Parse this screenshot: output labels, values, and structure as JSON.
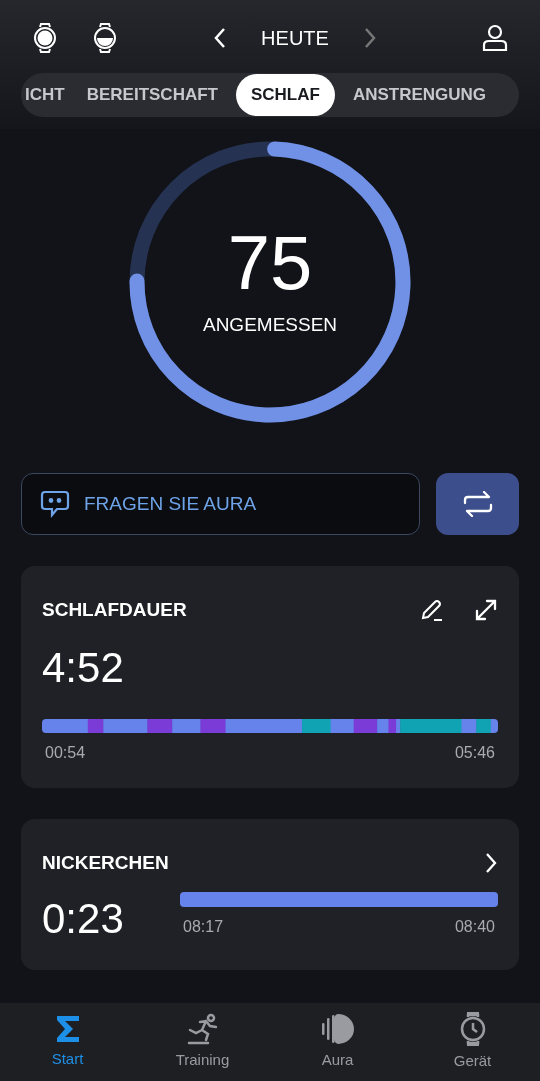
{
  "header": {
    "title": "HEUTE"
  },
  "tabs": [
    {
      "label": "ICHT",
      "selected": false
    },
    {
      "label": "BEREITSCHAFT",
      "selected": false
    },
    {
      "label": "SCHLAF",
      "selected": true
    },
    {
      "label": "ANSTRENGUNG",
      "selected": false
    }
  ],
  "score": {
    "value": "75",
    "label": "ANGEMESSEN",
    "level": 0.75
  },
  "ask_button": {
    "label": "FRAGEN SIE AURA"
  },
  "sleep_card": {
    "title": "SCHLAFDAUER",
    "duration": "4:52",
    "start": "00:54",
    "end": "05:46"
  },
  "nap_card": {
    "title": "NICKERCHEN",
    "duration": "0:23",
    "start": "08:17",
    "end": "08:40",
    "level": 1
  },
  "nav": [
    {
      "label": "Start",
      "selected": true,
      "kind": "sigma"
    },
    {
      "label": "Training",
      "selected": false,
      "kind": "runner"
    },
    {
      "label": "Aura",
      "selected": false,
      "kind": "aura"
    },
    {
      "label": "Gerät",
      "selected": false,
      "kind": "watch"
    }
  ]
}
